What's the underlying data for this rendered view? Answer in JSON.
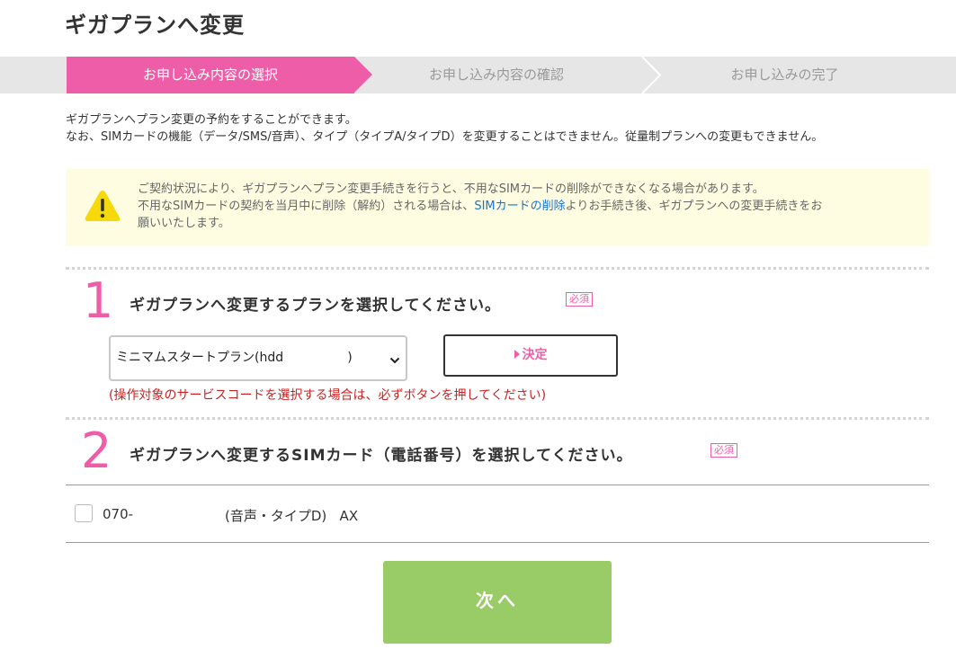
{
  "page": {
    "title": "ギガプランへ変更"
  },
  "stepper": {
    "steps": [
      {
        "label": "お申し込み内容の選択",
        "state": "active"
      },
      {
        "label": "お申し込み内容の確認",
        "state": "inactive"
      },
      {
        "label": "お申し込みの完了",
        "state": "inactive"
      }
    ]
  },
  "intro": {
    "line1": "ギガプランへプラン変更の予約をすることができます。",
    "line2": "なお、SIMカードの機能（データ/SMS/音声）、タイプ（タイプA/タイプD）を変更することはできません。従量制プランへの変更もできません。"
  },
  "notice": {
    "line1": "ご契約状況により、ギガプランへプラン変更手続きを行うと、不用なSIMカードの削除ができなくなる場合があります。",
    "line2_before": "不用なSIMカードの契約を当月中に削除（解約）される場合は、",
    "line2_link": "SIMカードの削除",
    "line2_after": "よりお手続き後、ギガプランへの変更手続きをお",
    "line3": "願いいたします。"
  },
  "section1": {
    "number": "1",
    "title": "ギガプランへ変更するプランを選択してください。",
    "badge": "必須",
    "select_value": "ミニマムスタートプラン(hdd                )",
    "decide_label": "決定",
    "hint": "(操作対象のサービスコードを選択する場合は、必ずボタンを押してください)"
  },
  "section2": {
    "number": "2",
    "title": "ギガプランへ変更するSIMカード（電話番号）を選択してください。",
    "badge": "必須",
    "sim_items": [
      {
        "number": "070-",
        "type": "(音声・タイプD)   AX",
        "checked": false
      }
    ]
  },
  "next_button": {
    "label": "次へ"
  },
  "colors": {
    "accent": "#ee5ea8",
    "next": "#99cc66",
    "error": "#cc2222",
    "link": "#1a73c8"
  }
}
